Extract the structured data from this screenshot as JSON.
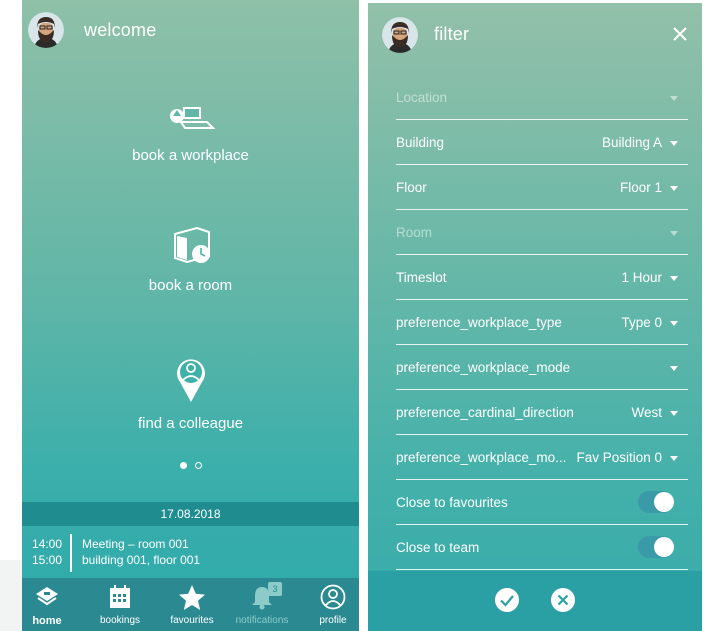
{
  "home": {
    "header": {
      "title": "welcome"
    },
    "actions": {
      "workplace": "book a workplace",
      "room": "book a room",
      "colleague": "find a colleague"
    },
    "carousel": {
      "pages": 2,
      "active_page": 1
    },
    "date": "17.08.2018",
    "agenda": {
      "start": "14:00",
      "end": "15:00",
      "title": "Meeting – room 001",
      "location": "building 001, floor 001"
    },
    "tabs": {
      "home": "home",
      "bookings": "bookings",
      "favourites": "favourites",
      "notifications": "notifications",
      "notifications_count": "3",
      "profile": "profile"
    }
  },
  "filter": {
    "header": {
      "title": "filter"
    },
    "rows": [
      {
        "label": "Location",
        "value": "",
        "disabled": true
      },
      {
        "label": "Building",
        "value": "Building A"
      },
      {
        "label": "Floor",
        "value": "Floor 1"
      },
      {
        "label": "Room",
        "value": "",
        "disabled": true
      },
      {
        "label": "Timeslot",
        "value": "1 Hour"
      },
      {
        "label": "preference_workplace_type",
        "value": "Type 0"
      },
      {
        "label": "preference_workplace_mode",
        "value": ""
      },
      {
        "label": "preference_cardinal_direction",
        "value": "West"
      },
      {
        "label": "preference_workplace_mo...",
        "value": "Fav Position 0"
      }
    ],
    "toggles": [
      {
        "label": "Close to favourites",
        "on": true
      },
      {
        "label": "Close to team",
        "on": true
      }
    ]
  },
  "colors": {
    "accent": "#2ea9ab",
    "tabbar": "#2b8a91",
    "date_bar": "#1f8c90",
    "toggle_track": "#3a9aa8"
  },
  "icons": {
    "workplace": "desk-icon",
    "room": "room-clock-icon",
    "colleague": "location-person-icon",
    "home": "home-icon",
    "bookings": "calendar-icon",
    "favourites": "star-icon",
    "notifications": "bell-icon",
    "profile": "person-icon",
    "confirm": "check-circle-icon",
    "cancel": "x-circle-icon",
    "close": "close-icon"
  }
}
